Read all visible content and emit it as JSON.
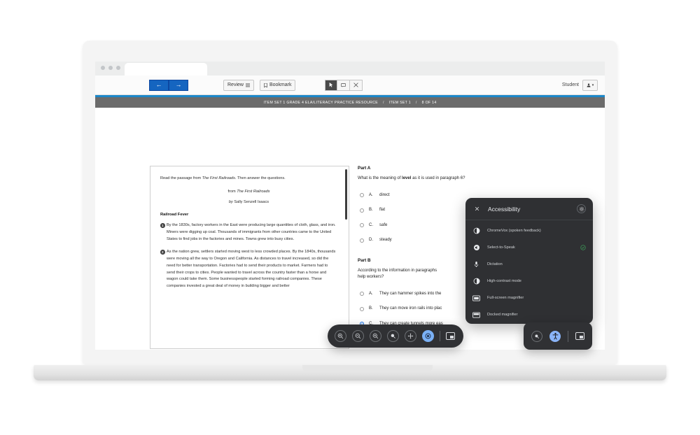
{
  "browser": {
    "tab_label": "",
    "window_dots": [
      "dot",
      "dot",
      "dot"
    ]
  },
  "toolbar": {
    "back_label": "←",
    "forward_label": "→",
    "review_label": "Review",
    "review_icon": "list-icon",
    "bookmark_label": "Bookmark",
    "bookmark_icon": "bookmark-icon",
    "pointer_icon": "pointer-icon",
    "notes_icon": "note-icon",
    "eliminator_icon": "strikethrough-icon",
    "student_label": "Student",
    "student_icon": "person-icon",
    "student_caret": "▾"
  },
  "breadcrumb": {
    "item_set_full": "ITEM SET 1 GRADE 4 ELA/LITERACY PRACTICE RESOURCE",
    "item_set_short": "ITEM SET 1",
    "page_indicator": "8 OF 14",
    "separator": "/"
  },
  "passage": {
    "instruction_a": "Read the passage from ",
    "instruction_title": "The First Railroads",
    "instruction_b": ". Then answer the questions.",
    "source_prefix": "from ",
    "source_title": "The First Railroads",
    "byline_prefix": "by",
    "byline_author": "Sally Senzell Isaacs",
    "heading": "Railroad Fever",
    "paragraphs": [
      {
        "number": "1",
        "text": "By the 1830s, factory workers in the East were producing large quantities of cloth, glass, and iron. Miners were digging up coal. Thousands of immigrants from other countries came to the United States to find jobs in the factories and mines. Towns grew into busy cities."
      },
      {
        "number": "2",
        "text": "As the nation grew, settlers started moving west to less crowded places. By the 1840s, thousands were moving all the way to Oregon and California. As distances to travel increased, so did the need for better transportation. Factories had to send their products to market. Farmers had to send their crops to cities. People wanted to travel across the country faster than a horse and wagon could take them. Some businesspeople started forming railroad companies. These companies invested a great deal of money in building bigger and better"
      }
    ]
  },
  "questions": [
    {
      "part_label": "Part A",
      "stem_before": "What is the meaning of ",
      "stem_bold": "level",
      "stem_after": " as it is used in paragraph 6?",
      "options": [
        {
          "letter": "A.",
          "text": "direct",
          "selected": false
        },
        {
          "letter": "B.",
          "text": "flat",
          "selected": false
        },
        {
          "letter": "C.",
          "text": "safe",
          "selected": false
        },
        {
          "letter": "D.",
          "text": "steady",
          "selected": false
        }
      ]
    },
    {
      "part_label": "Part B",
      "stem_line1": "According to the information in paragraphs",
      "stem_line2": "help workers?",
      "options": [
        {
          "letter": "A.",
          "text": "They can hammer spikes into the",
          "selected": false
        },
        {
          "letter": "B.",
          "text": "They can move iron rails into plac",
          "selected": false
        },
        {
          "letter": "C.",
          "text": "They can create tunnels more eas",
          "selected": true
        }
      ]
    }
  ],
  "accessibility_panel": {
    "title": "Accessibility",
    "close_icon": "close-icon",
    "settings_icon": "gear-icon",
    "items": [
      {
        "label": "ChromeVox (spoken feedback)",
        "icon": "chromevox-icon",
        "enabled": false
      },
      {
        "label": "Select-to-Speak",
        "icon": "speaker-icon",
        "enabled": true
      },
      {
        "label": "Dictation",
        "icon": "microphone-icon",
        "enabled": false
      },
      {
        "label": "High-contrast mode",
        "icon": "contrast-icon",
        "enabled": false
      },
      {
        "label": "Full-screen magnifier",
        "icon": "fullscreen-magnifier-icon",
        "enabled": false
      },
      {
        "label": "Docked magnifier",
        "icon": "docked-magnifier-icon",
        "enabled": false
      }
    ],
    "check_glyph": "✓"
  },
  "magnifier_toolbar": {
    "buttons": [
      {
        "icon": "zoom-in-icon",
        "active": false
      },
      {
        "icon": "zoom-out-icon",
        "active": false
      },
      {
        "icon": "zoom-reset-icon",
        "active": false
      },
      {
        "icon": "magnifier-shape-icon",
        "active": false
      },
      {
        "icon": "move-icon",
        "active": false
      },
      {
        "icon": "record-icon",
        "active": true
      }
    ],
    "screenshot_icon": "screenshot-icon"
  },
  "shelf": {
    "magnifier_icon": "magnifier-icon",
    "accessibility_icon": "accessibility-person-icon",
    "screenshot_icon": "screenshot-icon"
  },
  "colors": {
    "accent_blue": "#1565c0",
    "rule_blue": "#1b87c9",
    "breadcrumb_gray": "#6b6b6b",
    "panel_dark": "#2f3033",
    "selected_radio": "#1a73e8",
    "check_green": "#3ea55b",
    "active_button": "#7ab0f5"
  }
}
